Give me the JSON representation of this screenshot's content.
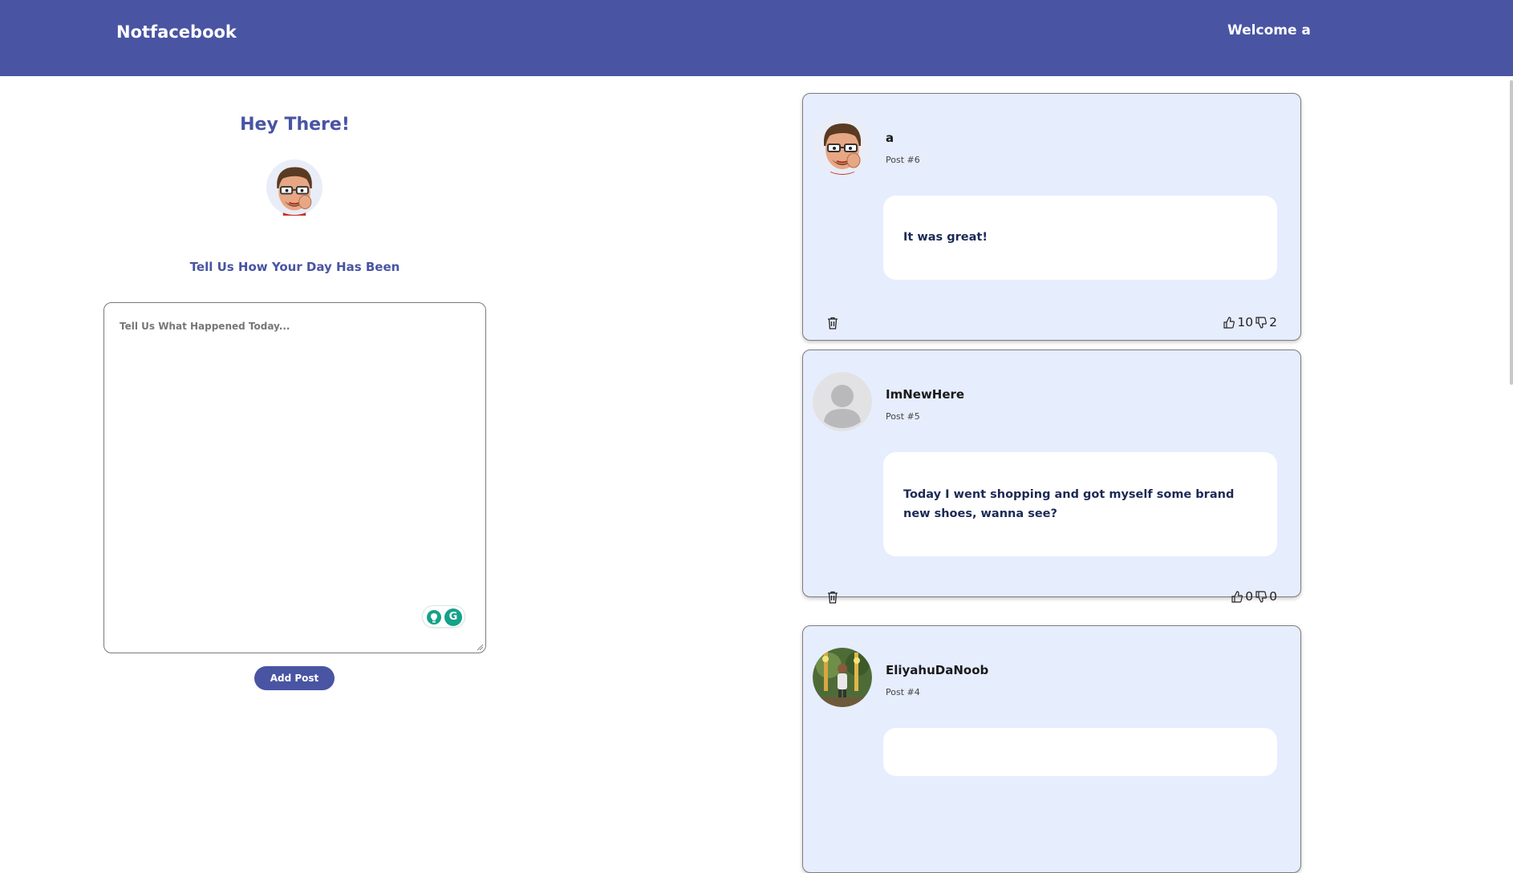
{
  "navbar": {
    "brand": "Notfacebook",
    "welcome": "Welcome a",
    "color": "#4954a3"
  },
  "left_panel": {
    "heading": "Hey There!",
    "prompt_title": "Tell Us How Your Day Has Been",
    "textarea_placeholder": "Tell Us What Happened Today...",
    "add_button_label": "Add Post"
  },
  "posts": [
    {
      "username": "a",
      "post_number": "Post #6",
      "text": "It was great!",
      "likes": "10",
      "dislikes": "2",
      "avatar": "cartoon-man-avatar"
    },
    {
      "username": "ImNewHere",
      "post_number": "Post #5",
      "text": "Today I went shopping and got myself some brand new shoes, wanna see?",
      "likes": "0",
      "dislikes": "0",
      "avatar": "default-user-avatar"
    },
    {
      "username": "EliyahuDaNoob",
      "post_number": "Post #4",
      "text": "",
      "likes": "",
      "dislikes": "",
      "avatar": "photo-avatar"
    }
  ],
  "icons": {
    "trash": "trash-icon",
    "like": "thumbs-up-icon",
    "dislike": "thumbs-down-icon",
    "grammarly": "grammarly-icon"
  }
}
